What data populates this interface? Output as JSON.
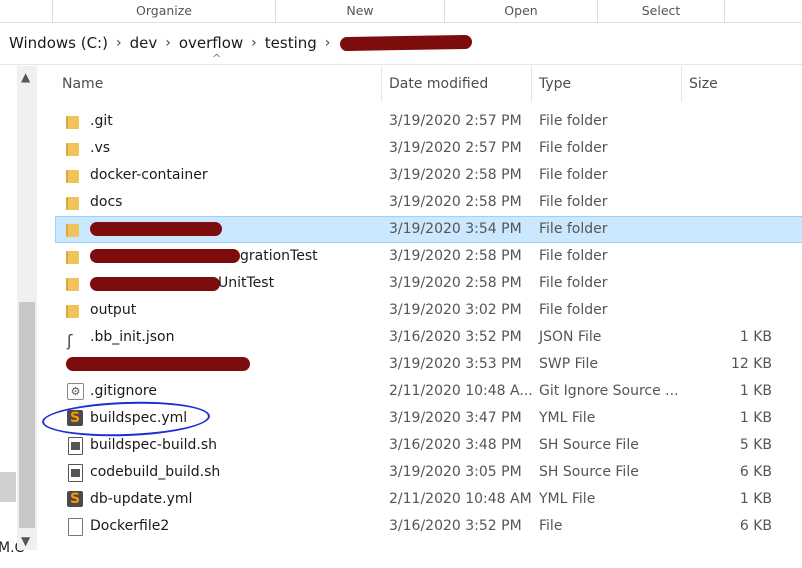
{
  "ribbon": {
    "groups": [
      "Organize",
      "New",
      "Open",
      "Select"
    ]
  },
  "address": {
    "crumbs": [
      "Windows (C:)",
      "dev",
      "overflow",
      "testing"
    ]
  },
  "nav": {
    "partial_text": "M.C"
  },
  "columns": {
    "name": "Name",
    "date": "Date modified",
    "type": "Type",
    "size": "Size"
  },
  "files": [
    {
      "name": ".git",
      "date": "3/19/2020 2:57 PM",
      "type": "File folder",
      "size": "",
      "icon": "folder-icon"
    },
    {
      "name": ".vs",
      "date": "3/19/2020 2:57 PM",
      "type": "File folder",
      "size": "",
      "icon": "folder-icon"
    },
    {
      "name": "docker-container",
      "date": "3/19/2020 2:58 PM",
      "type": "File folder",
      "size": "",
      "icon": "folder-icon"
    },
    {
      "name": "docs",
      "date": "3/19/2020 2:58 PM",
      "type": "File folder",
      "size": "",
      "icon": "folder-icon"
    },
    {
      "name": "",
      "date": "3/19/2020 3:54 PM",
      "type": "File folder",
      "size": "",
      "icon": "folder-icon",
      "selected": true
    },
    {
      "name": "grationTest",
      "date": "3/19/2020 2:58 PM",
      "type": "File folder",
      "size": "",
      "icon": "folder-icon"
    },
    {
      "name": "UnitTest",
      "date": "3/19/2020 2:58 PM",
      "type": "File folder",
      "size": "",
      "icon": "folder-icon"
    },
    {
      "name": "output",
      "date": "3/19/2020 3:02 PM",
      "type": "File folder",
      "size": "",
      "icon": "folder-icon"
    },
    {
      "name": ".bb_init.json",
      "date": "3/16/2020 3:52 PM",
      "type": "JSON File",
      "size": "1 KB",
      "icon": "json-icon"
    },
    {
      "name": "",
      "date": "3/19/2020 3:53 PM",
      "type": "SWP File",
      "size": "12 KB",
      "icon": "file-icon"
    },
    {
      "name": ".gitignore",
      "date": "2/11/2020 10:48 A...",
      "type": "Git Ignore Source ...",
      "size": "1 KB",
      "icon": "gear-file-icon"
    },
    {
      "name": "buildspec.yml",
      "date": "3/19/2020 3:47 PM",
      "type": "YML File",
      "size": "1 KB",
      "icon": "sublime-icon"
    },
    {
      "name": "buildspec-build.sh",
      "date": "3/16/2020 3:48 PM",
      "type": "SH Source File",
      "size": "5 KB",
      "icon": "script-icon"
    },
    {
      "name": "codebuild_build.sh",
      "date": "3/19/2020 3:05 PM",
      "type": "SH Source File",
      "size": "6 KB",
      "icon": "script-icon"
    },
    {
      "name": "db-update.yml",
      "date": "2/11/2020 10:48 AM",
      "type": "YML File",
      "size": "1 KB",
      "icon": "sublime-icon"
    },
    {
      "name": "Dockerfile2",
      "date": "3/16/2020 3:52 PM",
      "type": "File",
      "size": "6 KB",
      "icon": "file-icon"
    }
  ]
}
